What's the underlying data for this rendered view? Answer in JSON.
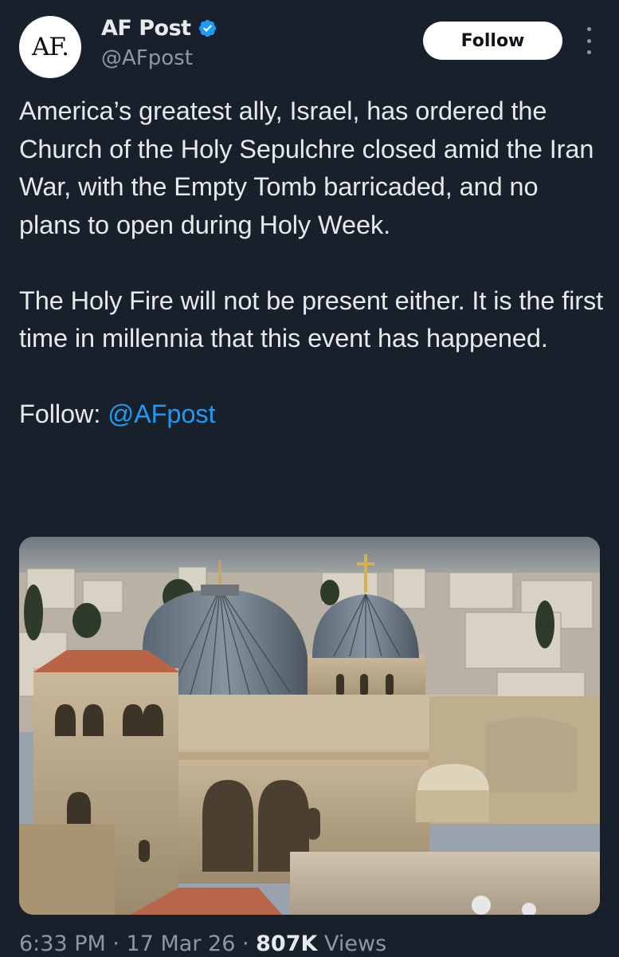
{
  "author": {
    "avatar_text": "AF.",
    "display_name": "AF Post",
    "verified_icon": "verified-badge-icon",
    "handle": "@AFpost"
  },
  "actions": {
    "follow_label": "Follow",
    "more_icon": "more-vertical-icon"
  },
  "tweet": {
    "paragraph_1": "America’s greatest ally, Israel, has ordered the Church of the Holy Sepulchre closed amid the Iran War, with the Empty Tomb barricaded, and no plans to open during Holy Week.",
    "paragraph_2": "The Holy Fire will not be present either. It is the first time in millennia that this event has happened.",
    "follow_prefix": "Follow: ",
    "follow_mention": "@AFpost"
  },
  "media": {
    "type": "photo"
  },
  "meta": {
    "time": "6:33 PM",
    "separator": " · ",
    "date": "17 Mar 26",
    "views_count": "807K",
    "views_label": " Views"
  },
  "colors": {
    "background": "#17202b",
    "text": "#e7e9ea",
    "secondary_text": "#8b98a5",
    "link": "#1d9bf0",
    "verified": "#1d9bf0"
  }
}
